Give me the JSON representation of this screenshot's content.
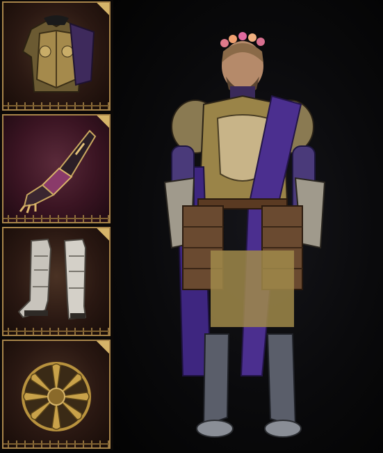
{
  "equipment": {
    "slots": [
      {
        "name": "chest-armor",
        "icon": "breastplate-icon",
        "rarity": "common"
      },
      {
        "name": "gloves",
        "icon": "gauntlet-icon",
        "rarity": "rare"
      },
      {
        "name": "boots",
        "icon": "greaves-icon",
        "rarity": "common"
      },
      {
        "name": "shield",
        "icon": "round-shield-icon",
        "rarity": "common"
      }
    ],
    "frame_color": "#a8854a"
  },
  "character": {
    "icon": "armored-knight-figure",
    "cape_color": "#4b2f8f",
    "armor_color": "#b99a4a"
  }
}
